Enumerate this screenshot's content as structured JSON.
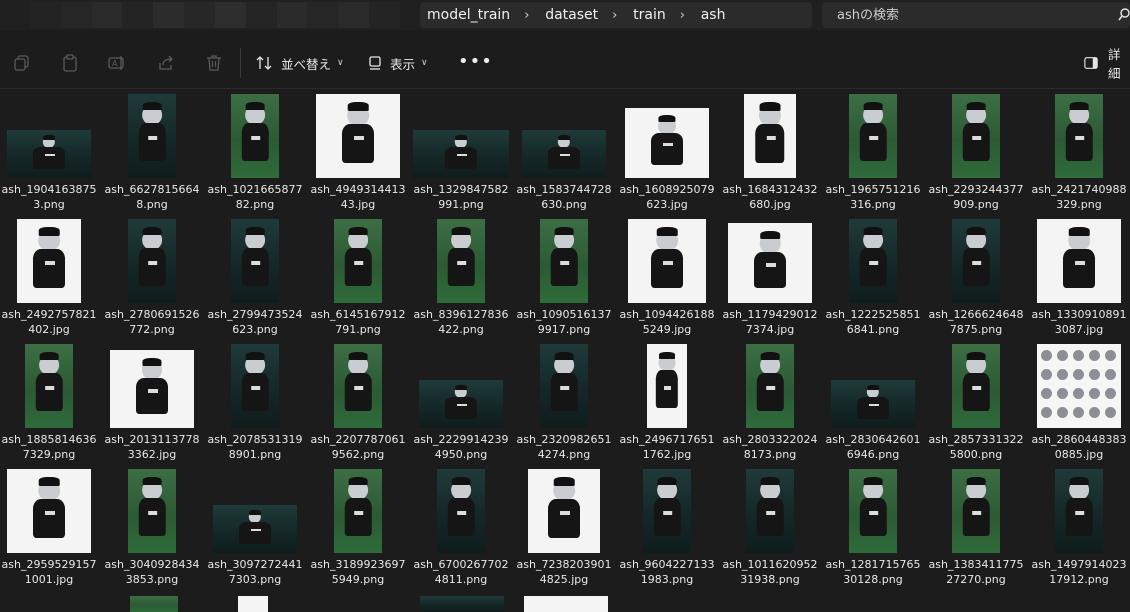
{
  "breadcrumb": [
    "model_train",
    "dataset",
    "train",
    "ash"
  ],
  "search": {
    "placeholder": "ashの検索"
  },
  "toolbar": {
    "sort_label": "並べ替え",
    "view_label": "表示",
    "more_label": "•••",
    "details_label": "詳細"
  },
  "icons": {
    "copy": "copy-icon",
    "paste": "paste-icon",
    "rename": "rename-icon",
    "share": "share-icon",
    "delete": "trash-icon",
    "sort": "sort-icon",
    "view": "view-icon",
    "details": "details-pane-icon",
    "search": "search-icon"
  },
  "colors": {
    "background": "#1c1c1c",
    "bar": "#202020",
    "field": "#2b2b2b"
  },
  "files": [
    [
      "ash_1904163875",
      "3.png"
    ],
    [
      "ash_6627815664",
      "8.png"
    ],
    [
      "ash_1021665877",
      "82.png"
    ],
    [
      "ash_4949314413",
      "43.jpg"
    ],
    [
      "ash_1329847582",
      "991.png"
    ],
    [
      "ash_1583744728",
      "630.png"
    ],
    [
      "ash_1608925079",
      "623.jpg"
    ],
    [
      "ash_1684312432",
      "680.jpg"
    ],
    [
      "ash_1965751216",
      "316.png"
    ],
    [
      "ash_2293244377",
      "909.png"
    ],
    [
      "ash_2421740988",
      "329.png"
    ],
    [
      "ash_2492757821",
      "402.jpg"
    ],
    [
      "ash_2780691526",
      "772.png"
    ],
    [
      "ash_2799473524",
      "623.png"
    ],
    [
      "ash_6145167912",
      "791.png"
    ],
    [
      "ash_8396127836",
      "422.png"
    ],
    [
      "ash_1090516137",
      "9917.png"
    ],
    [
      "ash_1094426188",
      "5249.jpg"
    ],
    [
      "ash_1179429012",
      "7374.jpg"
    ],
    [
      "ash_1222525851",
      "6841.png"
    ],
    [
      "ash_1266624648",
      "7875.png"
    ],
    [
      "ash_1330910891",
      "3087.jpg"
    ],
    [
      "ash_1885814636",
      "7329.png"
    ],
    [
      "ash_2013113778",
      "3362.jpg"
    ],
    [
      "ash_2078531319",
      "8901.png"
    ],
    [
      "ash_2207787061",
      "9562.png"
    ],
    [
      "ash_2229914239",
      "4950.png"
    ],
    [
      "ash_2320982651",
      "4274.png"
    ],
    [
      "ash_2496717651",
      "1762.jpg"
    ],
    [
      "ash_2803322024",
      "8173.png"
    ],
    [
      "ash_2830642601",
      "6946.png"
    ],
    [
      "ash_2857331322",
      "5800.png"
    ],
    [
      "ash_2860448383",
      "0885.jpg"
    ],
    [
      "ash_2959529157",
      "1001.jpg"
    ],
    [
      "ash_3040928434",
      "3853.png"
    ],
    [
      "ash_3097272441",
      "7303.png"
    ],
    [
      "ash_3189923697",
      "5949.png"
    ],
    [
      "ash_6700267702",
      "4811.png"
    ],
    [
      "ash_7238203901",
      "4825.jpg"
    ],
    [
      "ash_9604227133",
      "1983.png"
    ],
    [
      "ash_1011620952",
      "31938.png"
    ],
    [
      "ash_1281715765",
      "30128.png"
    ],
    [
      "ash_1383411775",
      "27270.png"
    ],
    [
      "ash_1497914023",
      "17912.png"
    ]
  ]
}
